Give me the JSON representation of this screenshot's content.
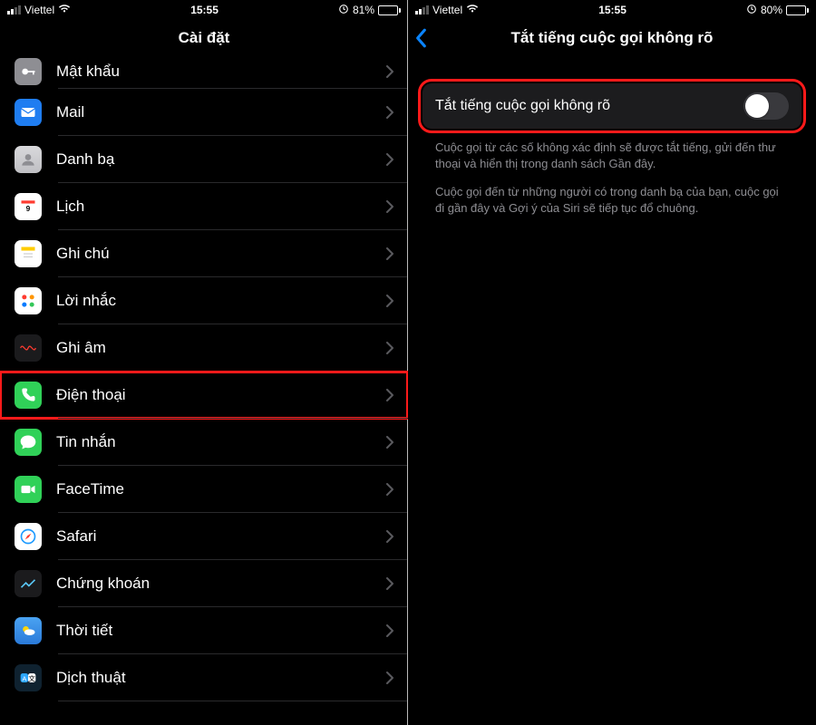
{
  "left": {
    "status": {
      "carrier": "Viettel",
      "wifi": "wifi-icon",
      "time": "15:55",
      "batteryPct": "81%",
      "batteryFill": 81
    },
    "title": "Cài đặt",
    "rows": [
      {
        "id": "passwords",
        "label": "Mật khẩu",
        "icon": "key-icon",
        "bg": "bg-gray"
      },
      {
        "id": "mail",
        "label": "Mail",
        "icon": "mail-icon",
        "bg": "bg-blue"
      },
      {
        "id": "contacts",
        "label": "Danh bạ",
        "icon": "contacts-icon",
        "bg": "bg-contacts"
      },
      {
        "id": "calendar",
        "label": "Lịch",
        "icon": "calendar-icon",
        "bg": "bg-white"
      },
      {
        "id": "notes",
        "label": "Ghi chú",
        "icon": "notes-icon",
        "bg": "bg-notes"
      },
      {
        "id": "reminders",
        "label": "Lời nhắc",
        "icon": "reminders-icon",
        "bg": "bg-white"
      },
      {
        "id": "voicememos",
        "label": "Ghi âm",
        "icon": "voicememos-icon",
        "bg": "bg-dark"
      },
      {
        "id": "phone",
        "label": "Điện thoại",
        "icon": "phone-icon",
        "bg": "bg-green",
        "highlight": true
      },
      {
        "id": "messages",
        "label": "Tin nhắn",
        "icon": "messages-icon",
        "bg": "bg-green"
      },
      {
        "id": "facetime",
        "label": "FaceTime",
        "icon": "facetime-icon",
        "bg": "bg-green"
      },
      {
        "id": "safari",
        "label": "Safari",
        "icon": "safari-icon",
        "bg": "bg-safari"
      },
      {
        "id": "stocks",
        "label": "Chứng khoán",
        "icon": "stocks-icon",
        "bg": "bg-dark"
      },
      {
        "id": "weather",
        "label": "Thời tiết",
        "icon": "weather-icon",
        "bg": "bg-weather"
      },
      {
        "id": "translate",
        "label": "Dịch thuật",
        "icon": "translate-icon",
        "bg": "bg-translate"
      }
    ]
  },
  "right": {
    "status": {
      "carrier": "Viettel",
      "wifi": "wifi-icon",
      "time": "15:55",
      "batteryPct": "80%",
      "batteryFill": 80
    },
    "title": "Tắt tiếng cuộc gọi không rõ",
    "toggle": {
      "label": "Tắt tiếng cuộc gọi không rõ",
      "on": false
    },
    "descr1": "Cuộc gọi từ các số không xác định sẽ được tắt tiếng, gửi đến thư thoại và hiển thị trong danh sách Gần đây.",
    "descr2": "Cuộc gọi đến từ những người có trong danh bạ của bạn, cuộc gọi đi gần đây và Gợi ý của Siri sẽ tiếp tục đổ chuông."
  }
}
